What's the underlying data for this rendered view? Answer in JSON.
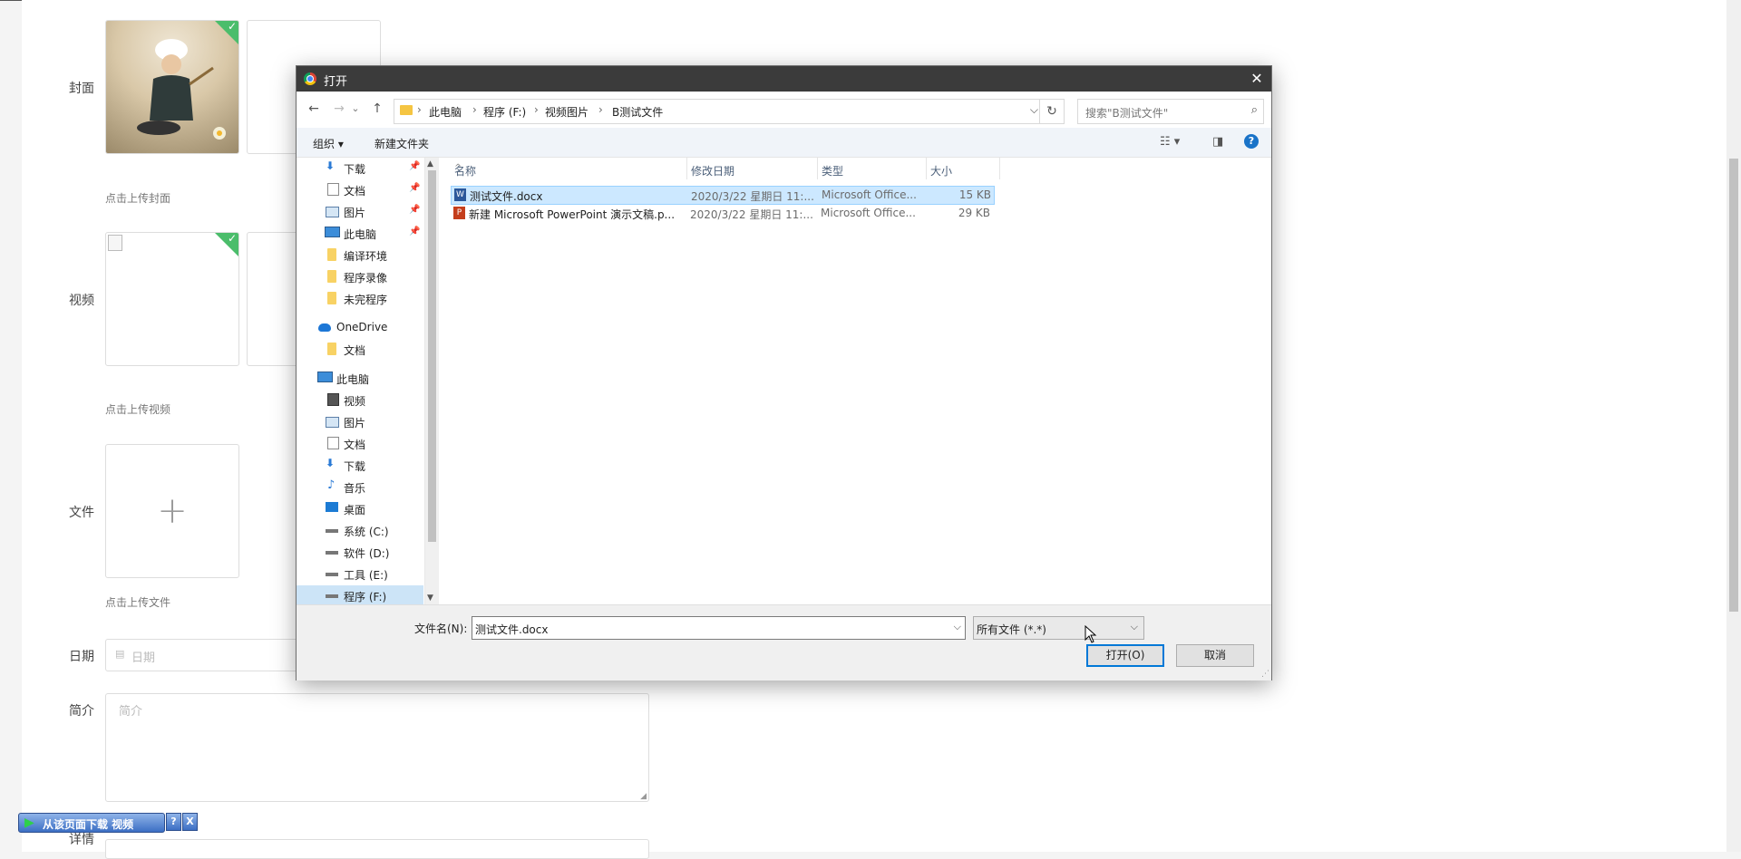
{
  "form": {
    "cover_label": "封面",
    "cover_hint": "点击上传封面",
    "video_label": "视频",
    "video_hint": "点击上传视频",
    "file_label": "文件",
    "file_hint": "点击上传文件",
    "date_label": "日期",
    "date_placeholder": "日期",
    "intro_label": "简介",
    "intro_placeholder": "简介",
    "detail_label": "详情",
    "plus": "+"
  },
  "dialog": {
    "title": "打开",
    "close": "✕",
    "nav": {
      "back": "←",
      "forward": "→",
      "recent": "⌄",
      "up": "↑"
    },
    "breadcrumbs": [
      "此电脑",
      "程序 (F:)",
      "视频图片",
      "B测试文件"
    ],
    "breadcrumb_sep": "›",
    "search_placeholder": "搜索\"B测试文件\"",
    "toolbar": {
      "organize": "组织 ▾",
      "new_folder": "新建文件夹",
      "help": "?"
    },
    "navpane": [
      {
        "label": "下载",
        "icon": "download-icon",
        "pinned": true
      },
      {
        "label": "文档",
        "icon": "document-icon",
        "pinned": true
      },
      {
        "label": "图片",
        "icon": "picture-icon",
        "pinned": true
      },
      {
        "label": "此电脑",
        "icon": "computer-icon",
        "pinned": true
      },
      {
        "label": "编译环境",
        "icon": "folder-icon",
        "pinned": false
      },
      {
        "label": "程序录像",
        "icon": "folder-icon",
        "pinned": false
      },
      {
        "label": "未完程序",
        "icon": "folder-icon",
        "pinned": false
      },
      {
        "label": "OneDrive",
        "icon": "cloud-icon",
        "pinned": false
      },
      {
        "label": "文档",
        "icon": "folder-icon",
        "pinned": false
      },
      {
        "label": "此电脑",
        "icon": "computer-icon",
        "pinned": false
      },
      {
        "label": "视频",
        "icon": "video-icon",
        "pinned": false
      },
      {
        "label": "图片",
        "icon": "picture-icon",
        "pinned": false
      },
      {
        "label": "文档",
        "icon": "document-icon",
        "pinned": false
      },
      {
        "label": "下载",
        "icon": "download-icon",
        "pinned": false
      },
      {
        "label": "音乐",
        "icon": "music-icon",
        "pinned": false
      },
      {
        "label": "桌面",
        "icon": "desktop-icon",
        "pinned": false
      },
      {
        "label": "系统 (C:)",
        "icon": "drive-icon",
        "pinned": false
      },
      {
        "label": "软件 (D:)",
        "icon": "drive-icon",
        "pinned": false
      },
      {
        "label": "工具 (E:)",
        "icon": "drive-icon",
        "pinned": false
      },
      {
        "label": "程序 (F:)",
        "icon": "drive-icon",
        "pinned": false,
        "selected": true
      }
    ],
    "columns": [
      "名称",
      "修改日期",
      "类型",
      "大小"
    ],
    "files": [
      {
        "name": "测试文件.docx",
        "date": "2020/3/22 星期日 11:...",
        "type": "Microsoft Office...",
        "size": "15 KB",
        "icon": "word-file-icon",
        "selected": true
      },
      {
        "name": "新建 Microsoft PowerPoint 演示文稿.p...",
        "date": "2020/3/22 星期日 11:...",
        "type": "Microsoft Office...",
        "size": "29 KB",
        "icon": "powerpoint-file-icon",
        "selected": false
      }
    ],
    "filename_label": "文件名(N):",
    "filename_value": "测试文件.docx",
    "filetype_value": "所有文件 (*.*)",
    "open_button": "打开(O)",
    "cancel_button": "取消"
  },
  "download_bar": {
    "label": "从该页面下载 视频",
    "help": "?",
    "close": "X"
  }
}
